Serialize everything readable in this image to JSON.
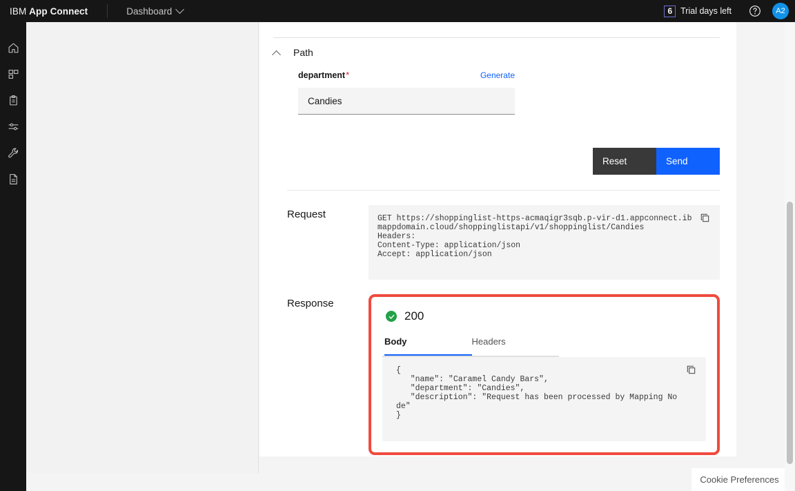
{
  "header": {
    "brand_light": "IBM",
    "brand_bold": "App Connect",
    "nav_item": "Dashboard",
    "chevron_icon": "chevron-down-icon",
    "trial_days": "6",
    "trial_label": "Trial days left",
    "help_icon": "help-circle-icon",
    "avatar_initials": "A2",
    "accent_blue": "#0f62fe",
    "avatar_color": "#1192e8",
    "trial_border_color": "#6f6fd4"
  },
  "sidebar": {
    "items": [
      {
        "name": "home-icon",
        "label": "Home"
      },
      {
        "name": "apps-icon",
        "label": "Apps"
      },
      {
        "name": "clipboard-icon",
        "label": "Catalog"
      },
      {
        "name": "sliders-icon",
        "label": "Settings"
      },
      {
        "name": "wrench-icon",
        "label": "Tools"
      },
      {
        "name": "document-icon",
        "label": "Documents"
      }
    ]
  },
  "path_section": {
    "collapse_icon": "chevron-up-icon",
    "title": "Path",
    "field_label": "department",
    "required_marker": "*",
    "generate_link": "Generate",
    "input_value": "Candies",
    "input_placeholder": ""
  },
  "actions": {
    "reset_label": "Reset",
    "send_label": "Send",
    "reset_color": "#393939",
    "send_color": "#0f62fe"
  },
  "request": {
    "label": "Request",
    "copy_icon": "copy-icon",
    "body": "GET https://shoppinglist-https-acmaqigr3sqb.p-vir-d1.appconnect.ibmappdomain.cloud/shoppinglistapi/v1/shoppinglist/Candies\nHeaders:\nContent-Type: application/json\nAccept: application/json"
  },
  "response": {
    "label": "Response",
    "status_icon": "success-check-icon",
    "status_code": "200",
    "status_color": "#24a148",
    "highlight_color": "#ef4b3e",
    "tabs": [
      {
        "label": "Body",
        "active": true
      },
      {
        "label": "Headers",
        "active": false
      }
    ],
    "copy_icon": "copy-icon",
    "body": "{\n   \"name\": \"Caramel Candy Bars\",\n   \"department\": \"Candies\",\n   \"description\": \"Request has been processed by Mapping Node\"\n}"
  },
  "footer": {
    "cookie_label": "Cookie Preferences"
  }
}
